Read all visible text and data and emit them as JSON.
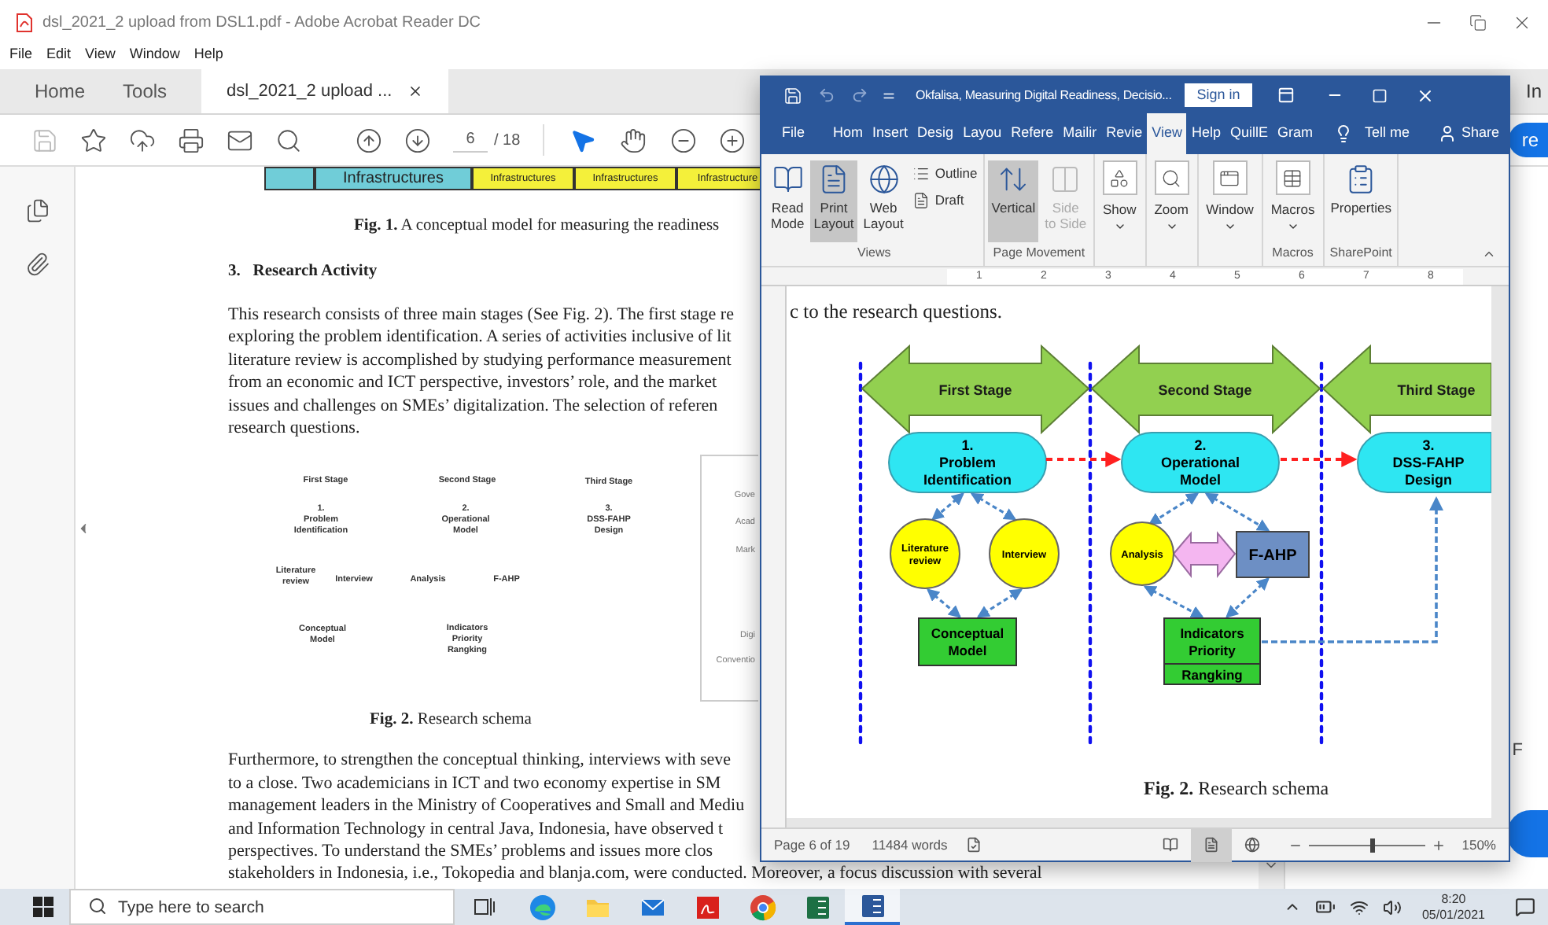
{
  "acrobat": {
    "title": "dsl_2021_2 upload from DSL1.pdf - Adobe Acrobat Reader DC",
    "menu": [
      "File",
      "Edit",
      "View",
      "Window",
      "Help"
    ],
    "tabs": [
      {
        "label": "Home",
        "selected": false
      },
      {
        "label": "Tools",
        "selected": false
      },
      {
        "label": "dsl_2021_2 upload ...",
        "selected": true
      }
    ],
    "sign_in": "In",
    "share": "re",
    "page_number": "6",
    "page_count": "/ 18",
    "page": {
      "table_cells": [
        {
          "kind": "main",
          "text": "Infrastructures"
        },
        {
          "kind": "sub",
          "text": "Infrastructures"
        },
        {
          "kind": "sub",
          "text": "Infrastructures"
        },
        {
          "kind": "sub",
          "text": "Infrastructure"
        }
      ],
      "fig1_caption": "**Fig. 1.** A conceptual model for measuring the readiness",
      "heading": "3.   Research Activity",
      "paragraph_1": [
        "This research consists of three main stages (See Fig. 2). The first stage re",
        "exploring the problem identification. A series of activities inclusive of lit",
        "literature review is accomplished by studying performance measurement",
        "from an economic and ICT perspective, investors’ role, and the market",
        "issues and challenges on SMEs’ digitalization. The selection of referen",
        "research questions."
      ],
      "figure_labels": [
        {
          "lines": [
            "First Stage"
          ]
        },
        {
          "lines": [
            "Second Stage"
          ]
        },
        {
          "lines": [
            "Third Stage"
          ]
        },
        {
          "lines": [
            "1.",
            "Problem",
            "Identification"
          ]
        },
        {
          "lines": [
            "2.",
            "Operational",
            "Model"
          ]
        },
        {
          "lines": [
            "3.",
            "DSS-FAHP",
            "Design"
          ]
        },
        {
          "lines": [
            "Literature",
            "review"
          ]
        },
        {
          "lines": [
            "Interview"
          ]
        },
        {
          "lines": [
            "Analysis"
          ]
        },
        {
          "lines": [
            "F-AHP"
          ]
        },
        {
          "lines": [
            "Conceptual",
            "Model"
          ]
        },
        {
          "lines": [
            "Indicators",
            "Priority",
            "Rangking"
          ]
        }
      ],
      "figure_side_labels": [
        "Gove",
        "Acad",
        "Mark",
        "Digi",
        "Conventio"
      ],
      "fig2_caption": "**Fig. 2.** Research schema",
      "paragraph_2": [
        "Furthermore, to strengthen the conceptual thinking, interviews with seve",
        "to a close. Two academicians in ICT and two economy expertise in SM",
        "management leaders in the Ministry of Cooperatives and Small and Mediu",
        "and Information Technology in central Java, Indonesia, have observed t",
        "perspectives. To understand the SMEs’ problems and issues more clos",
        "stakeholders in Indonesia, i.e., Tokopedia and blanja.com, were conducted. Moreover, a focus discussion with several"
      ]
    },
    "side_panel_text": "F"
  },
  "word": {
    "title": "Okfalisa, Measuring Digital Readiness, Decisio...",
    "sign_in": "Sign in",
    "tabs": [
      {
        "label": "File",
        "selected": false
      },
      {
        "label": "Hom",
        "selected": false
      },
      {
        "label": "Insert",
        "selected": false
      },
      {
        "label": "Desig",
        "selected": false
      },
      {
        "label": "Layou",
        "selected": false
      },
      {
        "label": "Refere",
        "selected": false
      },
      {
        "label": "Mailir",
        "selected": false
      },
      {
        "label": "Revie",
        "selected": false
      },
      {
        "label": "View",
        "selected": true
      },
      {
        "label": "Help",
        "selected": false
      },
      {
        "label": "QuillE",
        "selected": false
      },
      {
        "label": "Gram",
        "selected": false
      }
    ],
    "tell_me": "Tell me",
    "share": "Share",
    "ribbon_groups": [
      {
        "label": "Views",
        "buttons": [
          {
            "kind": "large",
            "label": "Read\nMode",
            "selected": false,
            "disabled": false
          },
          {
            "kind": "large",
            "label": "Print\nLayout",
            "selected": true,
            "disabled": false
          },
          {
            "kind": "large",
            "label": "Web\nLayout",
            "selected": false,
            "disabled": false
          },
          {
            "kind": "small",
            "label": "Outline",
            "selected": false,
            "disabled": false
          },
          {
            "kind": "small",
            "label": "Draft",
            "selected": false,
            "disabled": false
          }
        ]
      },
      {
        "label": "Page Movement",
        "buttons": [
          {
            "kind": "large",
            "label": "Vertical",
            "selected": true,
            "disabled": false
          },
          {
            "kind": "large",
            "label": "Side\nto Side",
            "selected": false,
            "disabled": true
          }
        ]
      },
      {
        "buttons": [
          {
            "kind": "dropdown",
            "label": "Show"
          }
        ]
      },
      {
        "buttons": [
          {
            "kind": "dropdown",
            "label": "Zoom"
          }
        ]
      },
      {
        "buttons": [
          {
            "kind": "dropdown",
            "label": "Window"
          }
        ]
      },
      {
        "label": "Macros",
        "buttons": [
          {
            "kind": "dropdown",
            "label": "Macros"
          }
        ]
      },
      {
        "label": "SharePoint",
        "buttons": [
          {
            "kind": "large",
            "label": "Properties",
            "selected": false,
            "disabled": false
          }
        ]
      }
    ],
    "ruler": [
      "1",
      "2",
      "3",
      "4",
      "5",
      "6",
      "7",
      "8"
    ],
    "page": {
      "text_line": "c to the research questions.",
      "diagram": {
        "stages": [
          {
            "label": "First Stage"
          },
          {
            "label": "Second Stage"
          },
          {
            "label": "Third Stage"
          }
        ],
        "steps": [
          {
            "lines": [
              "1.",
              "Problem",
              "Identification"
            ]
          },
          {
            "lines": [
              "2.",
              "Operational",
              "Model"
            ]
          },
          {
            "lines": [
              "3.",
              "DSS-FAHP",
              "Design"
            ]
          }
        ],
        "activities": [
          {
            "kind": "circle",
            "lines": [
              "Literature",
              "review"
            ]
          },
          {
            "kind": "circle",
            "lines": [
              "Interview"
            ]
          },
          {
            "kind": "circle",
            "lines": [
              "Analysis"
            ]
          },
          {
            "kind": "box",
            "lines": [
              "F-AHP"
            ]
          }
        ],
        "outputs": [
          {
            "lines": [
              "Conceptual",
              "Model"
            ]
          },
          {
            "lines": [
              "Indicators",
              "Priority",
              "Rangking"
            ]
          }
        ]
      },
      "caption": "**Fig. 2.** Research schema"
    },
    "status": {
      "page": "Page 6 of 19",
      "words": "11484 words",
      "views": [
        {
          "selected": false
        },
        {
          "selected": true
        },
        {
          "selected": false
        }
      ],
      "zoom": {
        "level": 0.53
      },
      "zoom_text": "150%"
    }
  },
  "taskbar": {
    "search_placeholder": "Type here to search",
    "apps": [
      {
        "selected": false
      },
      {
        "selected": false
      },
      {
        "selected": false
      },
      {
        "selected": false
      },
      {
        "selected": false
      },
      {
        "selected": false
      },
      {
        "selected": true
      }
    ],
    "time": "8:20",
    "date": "05/01/2021"
  }
}
